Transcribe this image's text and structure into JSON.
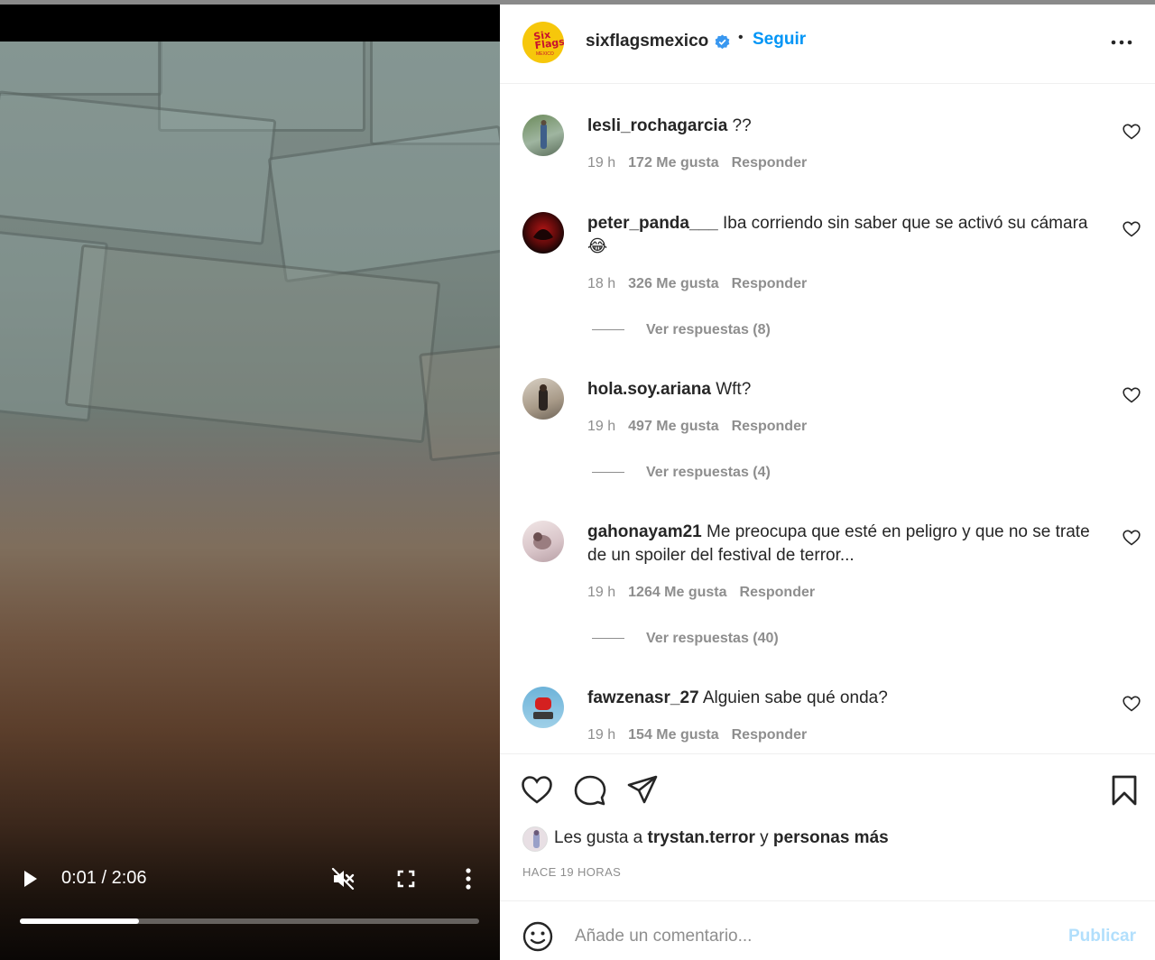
{
  "video": {
    "time_current": "0:01",
    "time_total": "2:06",
    "time_display": "0:01 / 2:06",
    "progress_fraction": 0.26,
    "muted": true,
    "icons": {
      "play": "play-icon",
      "mute": "volume-muted-icon",
      "fullscreen": "fullscreen-icon",
      "more": "more-vertical-icon"
    }
  },
  "post": {
    "author": "sixflagsmexico",
    "avatar_text": "Six Flags",
    "avatar_subtext": "MEXICO",
    "verified": true,
    "separator": "•",
    "follow_label": "Seguir",
    "accent_color": "#0095f6"
  },
  "comments": [
    {
      "user": "lesli_rochagarcia",
      "text": "??",
      "time": "19 h",
      "likes": "172 Me gusta",
      "reply": "Responder",
      "replies": ""
    },
    {
      "user": "peter_panda___",
      "text": "Iba corriendo sin saber que se activó su cámara 😂",
      "time": "18 h",
      "likes": "326 Me gusta",
      "reply": "Responder",
      "replies": "Ver respuestas (8)"
    },
    {
      "user": "hola.soy.ariana",
      "text": "Wft?",
      "time": "19 h",
      "likes": "497 Me gusta",
      "reply": "Responder",
      "replies": "Ver respuestas (4)"
    },
    {
      "user": "gahonayam21",
      "text": "Me preocupa que esté en peligro y que no se trate de un spoiler del festival de terror...",
      "time": "19 h",
      "likes": "1264 Me gusta",
      "reply": "Responder",
      "replies": "Ver respuestas (40)"
    },
    {
      "user": "fawzenasr_27",
      "text": "Alguien sabe qué onda?",
      "time": "19 h",
      "likes": "154 Me gusta",
      "reply": "Responder",
      "replies": ""
    }
  ],
  "likes_line": {
    "prefix": "Les gusta a",
    "user": "trystan.terror",
    "joiner": "y",
    "others": "personas más"
  },
  "time_ago": "HACE 19 HORAS",
  "composer": {
    "placeholder": "Añade un comentario...",
    "publish_label": "Publicar",
    "publish_color": "#b2dffc"
  }
}
